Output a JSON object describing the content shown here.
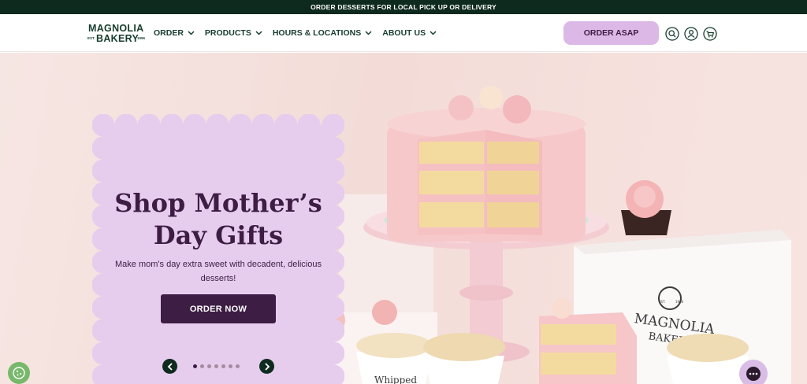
{
  "announcement": "ORDER DESSERTS FOR LOCAL PICK UP OR DELIVERY",
  "logo": {
    "line1": "MAGNOLIA",
    "line2": "BAKERY",
    "est": "EST.",
    "year": "1996"
  },
  "nav": [
    {
      "label": "ORDER"
    },
    {
      "label": "PRODUCTS"
    },
    {
      "label": "HOURS & LOCATIONS"
    },
    {
      "label": "ABOUT US"
    }
  ],
  "header_actions": {
    "order_asap": "ORDER ASAP",
    "icons": [
      "search-icon",
      "account-icon",
      "cart-icon"
    ]
  },
  "hero": {
    "title_line1": "Shop Mother’s",
    "title_line2": "Day Gifts",
    "subtitle_line1": "Make mom's day extra sweet with decadent, delicious",
    "subtitle_line2": "desserts!",
    "cta": "ORDER NOW",
    "slides_total": 7,
    "active_slide": 1
  },
  "image_text": {
    "box_line1": "MAGNOLIA",
    "box_line2": "BAKERY",
    "box_est": "EST.",
    "box_year": "1996",
    "cup_text": "Whipped"
  },
  "colors": {
    "announce_bg": "#0e2a1f",
    "brand_green": "#173d2e",
    "lavender": "#dcb8e6",
    "plum": "#3e1d44",
    "hero_bg": "#f3dcd8"
  }
}
